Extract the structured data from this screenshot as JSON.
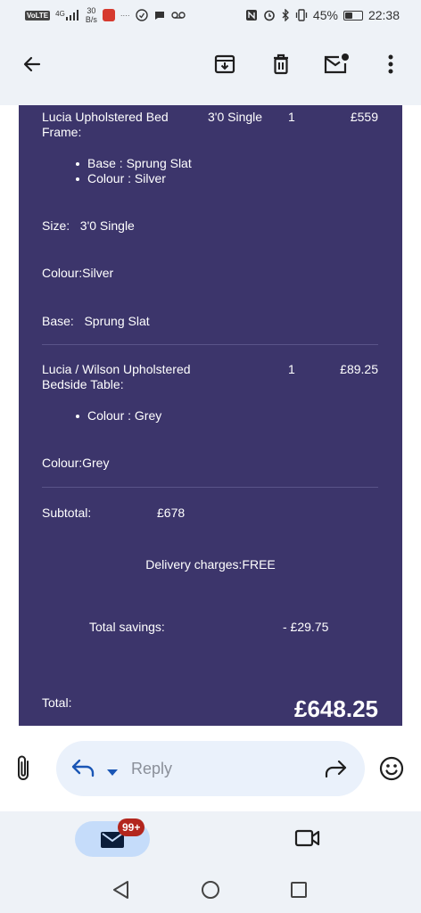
{
  "status_bar": {
    "network_badge": "VoLTE",
    "signal_label": "4G",
    "net_speed_value": "30",
    "net_speed_unit": "B/s",
    "battery": "45%",
    "time": "22:38",
    "icons": [
      "volte-icon",
      "signal-icon",
      "app-notification-icon",
      "shield-icon",
      "chat-icon",
      "voicemail-icon",
      "nfc-icon",
      "alarm-icon",
      "bluetooth-icon",
      "vibrate-icon",
      "battery-icon"
    ],
    "battery_level": 0.45
  },
  "toolbar": {
    "icons": [
      "back-arrow-icon",
      "archive-icon",
      "delete-icon",
      "mark-unread-icon",
      "more-options-icon"
    ]
  },
  "order": {
    "items": [
      {
        "name": "Lucia Upholstered Bed Frame:",
        "size": "3'0 Single",
        "qty": "1",
        "price": "£559",
        "options": [
          "Base : Sprung Slat",
          "Colour : Silver"
        ],
        "size_line": "Size:   3'0 Single",
        "colour_line": "Colour:Silver",
        "base_line": "Base:   Sprung Slat"
      },
      {
        "name": "Lucia / Wilson Upholstered Bedside Table:",
        "qty": "1",
        "price": "£89.25",
        "options": [
          "Colour : Grey"
        ],
        "colour_line": "Colour:Grey"
      }
    ],
    "subtotal_label": "Subtotal:",
    "subtotal_value": "£678",
    "delivery_text": "Delivery charges:FREE",
    "savings_label": "Total savings:",
    "savings_value": "- £29.75",
    "total_label": "Total:",
    "total_value": "£648.25"
  },
  "reply_bar": {
    "reply_label": "Reply",
    "icons": [
      "attachment-icon",
      "reply-arrow-icon",
      "reply-dropdown-icon",
      "forward-icon",
      "emoji-icon"
    ]
  },
  "bottom_nav": {
    "badge": "99+",
    "icons": [
      "mail-icon",
      "video-call-icon"
    ]
  },
  "system_nav": {
    "icons": [
      "back-triangle-icon",
      "home-circle-icon",
      "recents-square-icon"
    ]
  },
  "colors": {
    "accent": "#1a56b5",
    "email_background": "#3c356b",
    "badge": "#b3261e",
    "chrome": "#eef2f7"
  }
}
